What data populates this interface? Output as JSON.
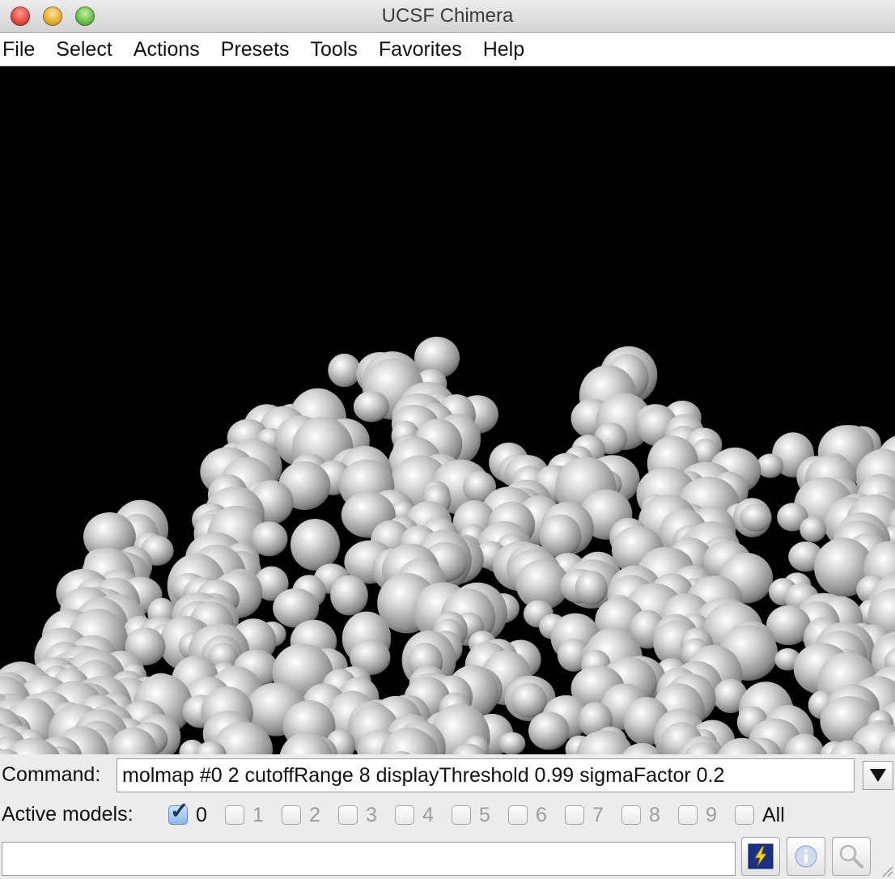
{
  "window": {
    "title": "UCSF Chimera"
  },
  "menu": [
    "File",
    "Select",
    "Actions",
    "Presets",
    "Tools",
    "Favorites",
    "Help"
  ],
  "command": {
    "label": "Command:",
    "value": "molmap #0 2 cutoffRange 8 displayThreshold 0.99 sigmaFactor 0.2"
  },
  "active_models": {
    "label": "Active models:",
    "models": [
      {
        "label": "0",
        "checked": true
      },
      {
        "label": "1",
        "checked": false
      },
      {
        "label": "2",
        "checked": false
      },
      {
        "label": "3",
        "checked": false
      },
      {
        "label": "4",
        "checked": false
      },
      {
        "label": "5",
        "checked": false
      },
      {
        "label": "6",
        "checked": false
      },
      {
        "label": "7",
        "checked": false
      },
      {
        "label": "8",
        "checked": false
      },
      {
        "label": "9",
        "checked": false
      }
    ],
    "all_label": "All"
  },
  "toolbar_icons": [
    "lightning-icon",
    "info-icon",
    "magnifier-icon"
  ],
  "colors": {
    "viewport_bg": "#000000",
    "surface": "#b9b9b9"
  }
}
